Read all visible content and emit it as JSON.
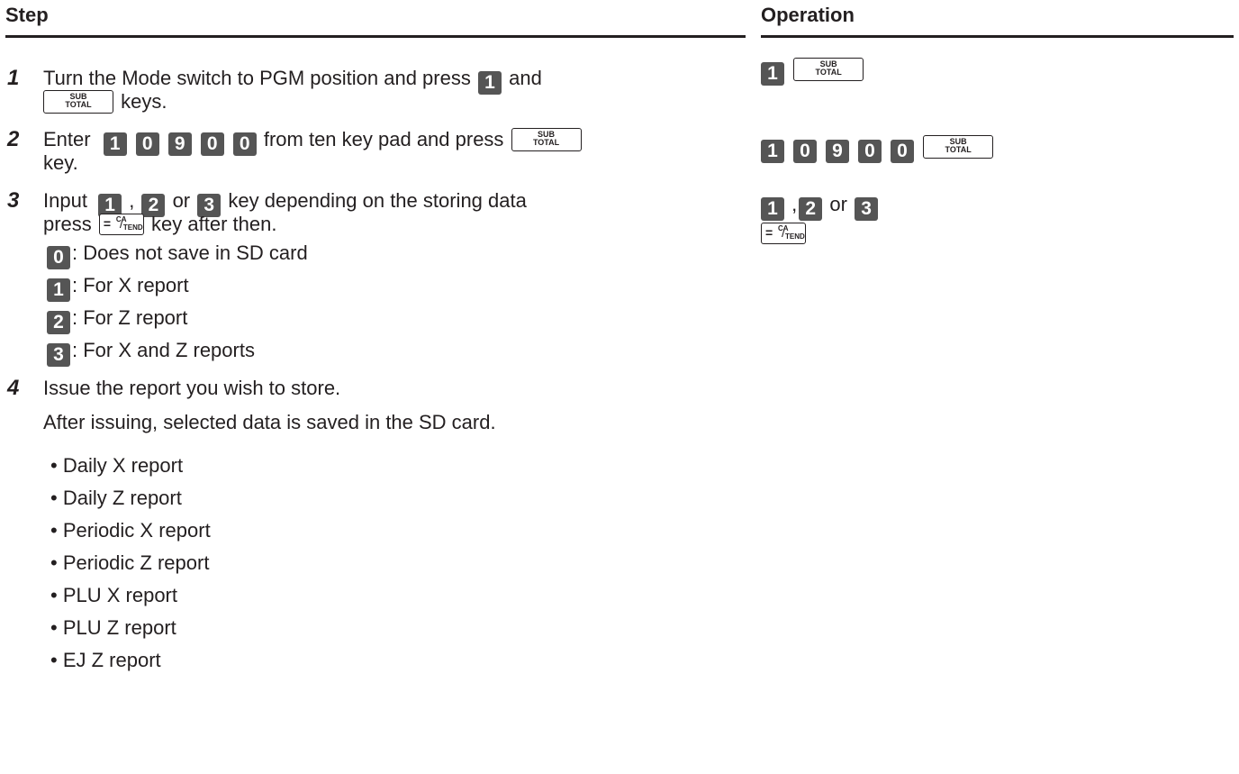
{
  "header": {
    "step": "Step",
    "operation": "Operation"
  },
  "keys": {
    "sub_total_top": "SUB",
    "sub_total_bottom": "TOTAL",
    "equals": "=",
    "ca": "CA",
    "amt": "AMT",
    "tend": "TEND",
    "slash": "/",
    "k0": "0",
    "k1": "1",
    "k2": "2",
    "k3": "3",
    "k9": "9"
  },
  "steps": [
    {
      "num": "1",
      "line1_a": "Turn the Mode switch to PGM position and press",
      "line1_b": "and",
      "line2_b": "keys."
    },
    {
      "num": "2",
      "line1_a": "Enter",
      "line1_b": "from ten key pad and press",
      "line2": "key."
    },
    {
      "num": "3",
      "line1_a": "Input",
      "comma": ",",
      "or": "or",
      "line1_b": "key depending on the storing data",
      "line2_a": "press",
      "line2_b": "key after then.",
      "options": [
        {
          "key": "0",
          "text": ": Does not save in SD card"
        },
        {
          "key": "1",
          "text": ": For X report"
        },
        {
          "key": "2",
          "text": ": For Z report"
        },
        {
          "key": "3",
          "text": ": For X and Z reports"
        }
      ]
    },
    {
      "num": "4",
      "line1": "Issue the report you wish to store.",
      "line2": "After issuing, selected data is saved in the SD card.",
      "reports": [
        "Daily X report",
        "Daily Z report",
        "Periodic X report",
        "Periodic Z report",
        "PLU X report",
        "PLU Z report",
        "EJ Z report"
      ]
    }
  ],
  "operation": {
    "comma": ",",
    "or": "or"
  }
}
